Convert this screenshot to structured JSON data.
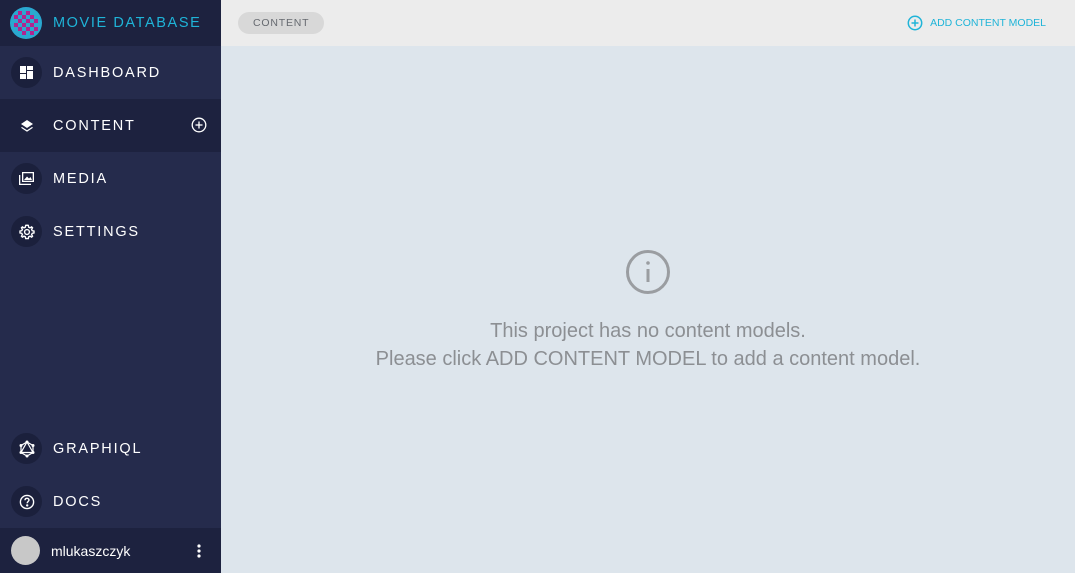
{
  "brand": {
    "title": "MOVIE DATABASE",
    "accent_color": "#1fb4d8"
  },
  "sidebar": {
    "items": [
      {
        "label": "DASHBOARD",
        "icon": "dashboard-icon"
      },
      {
        "label": "CONTENT",
        "icon": "layers-icon",
        "active": true,
        "has_add": true
      },
      {
        "label": "MEDIA",
        "icon": "photo-library-icon"
      },
      {
        "label": "SETTINGS",
        "icon": "gear-icon"
      }
    ],
    "bottom_items": [
      {
        "label": "GRAPHIQL",
        "icon": "graphql-icon"
      },
      {
        "label": "DOCS",
        "icon": "help-icon"
      }
    ],
    "user": {
      "name": "mlukaszczyk"
    }
  },
  "topbar": {
    "breadcrumb": "CONTENT",
    "add_button_label": "ADD CONTENT MODEL"
  },
  "empty_state": {
    "icon": "info-icon",
    "line1": "This project has no content models.",
    "line2": "Please click ADD CONTENT MODEL to add a content model."
  }
}
